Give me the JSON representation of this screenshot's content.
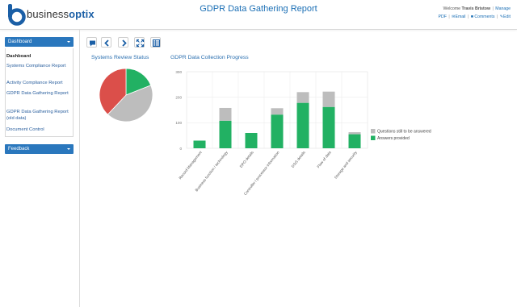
{
  "header": {
    "logo_text": "business",
    "logo_text_bold": "optix",
    "report_title": "GDPR Data Gathering Report",
    "welcome_prefix": "Welcome",
    "user_name": "Travis Bristow",
    "manage_label": "Manage",
    "links": {
      "pdf": "PDF",
      "email": "Email",
      "comments": "Comments",
      "edit": "Edit"
    }
  },
  "sidebar": {
    "dashboard_header": "Dashboard",
    "items": [
      {
        "label": "Dashboard"
      },
      {
        "label": "Systems Compliance Report"
      },
      {
        "label": "Activity Compliance Report"
      },
      {
        "label": "GDPR Data Gathering Report"
      },
      {
        "label": "GDPR Data Gathering Report (old data)"
      },
      {
        "label": "Document Control"
      }
    ],
    "feedback_header": "Feedback"
  },
  "toolbar": {
    "icons": [
      "comment-icon",
      "chevron-left-icon",
      "chevron-right-icon",
      "expand-icon",
      "table-icon"
    ]
  },
  "charts": {
    "pie_title": "Systems Review Status",
    "bar_title": "GDPR Data Collection Progress"
  },
  "chart_data": [
    {
      "type": "pie",
      "title": "Systems Review Status",
      "slices": [
        {
          "value": 0.19,
          "color": "#22b163"
        },
        {
          "value": 0.43,
          "color": "#bdbdbd"
        },
        {
          "value": 0.38,
          "color": "#db4f4a"
        }
      ]
    },
    {
      "type": "bar",
      "stacked": true,
      "title": "GDPR Data Collection Progress",
      "categories": [
        "Record Management",
        "Business function / technology",
        "DPO details",
        "Controller / processor information",
        "DSG details",
        "Flow of data",
        "Storage and security"
      ],
      "series": [
        {
          "name": "Answers provided",
          "color": "#22b163",
          "values": [
            30,
            108,
            60,
            132,
            178,
            162,
            55
          ]
        },
        {
          "name": "Questions still to be answered",
          "color": "#bdbdbd",
          "values": [
            0,
            50,
            0,
            25,
            42,
            60,
            8
          ]
        }
      ],
      "ylim": [
        0,
        300
      ],
      "yticks": [
        "0",
        "100",
        "200",
        "300"
      ],
      "legend_position": "right"
    }
  ]
}
